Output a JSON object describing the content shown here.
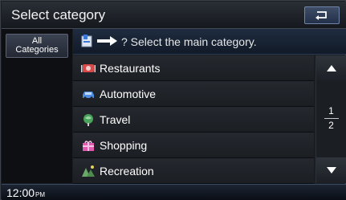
{
  "header": {
    "title": "Select category",
    "back_icon": "back-arrow-icon"
  },
  "left_panel": {
    "all_categories_line1": "All",
    "all_categories_line2": "Categories"
  },
  "instruction": {
    "icon": "map-flag-icon",
    "arrow_icon": "right-arrow-icon",
    "text": "? Select the main category."
  },
  "categories": [
    {
      "label": "Restaurants",
      "icon": "restaurant-icon"
    },
    {
      "label": "Automotive",
      "icon": "car-icon"
    },
    {
      "label": "Travel",
      "icon": "travel-icon"
    },
    {
      "label": "Shopping",
      "icon": "shopping-icon"
    },
    {
      "label": "Recreation",
      "icon": "recreation-icon"
    }
  ],
  "scrollbar": {
    "current_page": "1",
    "total_pages": "2"
  },
  "status": {
    "time": "12:00",
    "ampm": "PM"
  },
  "colors": {
    "background": "#1a1d22",
    "accent_blue": "#1f2c40",
    "text": "#ffffff"
  }
}
